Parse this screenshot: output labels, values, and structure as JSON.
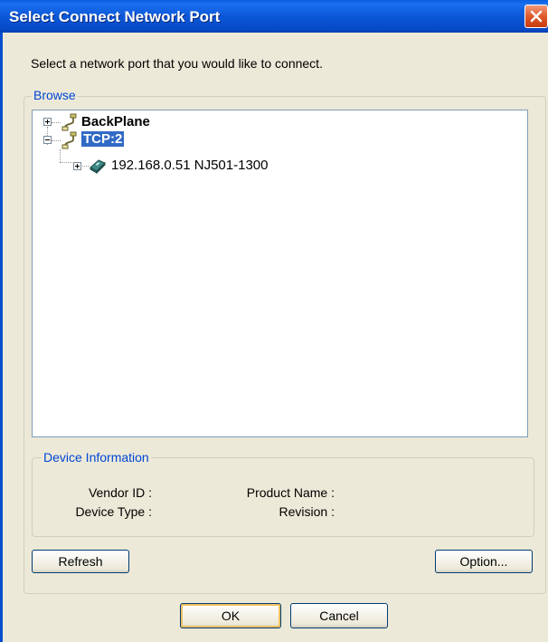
{
  "window": {
    "title": "Select Connect Network Port"
  },
  "prompt": "Select a network port that you would like to connect.",
  "browse": {
    "label": "Browse",
    "tree": [
      {
        "label": "BackPlane",
        "icon": "port-plug-icon",
        "expanded": false,
        "bold": true
      },
      {
        "label": "TCP:2",
        "icon": "port-plug-icon",
        "expanded": true,
        "bold": true,
        "selected": true
      },
      {
        "label": "192.168.0.51 NJ501-1300",
        "icon": "controller-device-icon",
        "expanded": false,
        "bold": false
      }
    ]
  },
  "device_info": {
    "label": "Device Information",
    "vendor_id_label": "Vendor ID :",
    "device_type_label": "Device Type :",
    "product_name_label": "Product Name :",
    "revision_label": "Revision :"
  },
  "buttons": {
    "refresh": "Refresh",
    "option": "Option...",
    "ok": "OK",
    "cancel": "Cancel"
  },
  "colors": {
    "titlebar": "#0a5fe0",
    "selection": "#316ac5",
    "groupbox_label": "#0046d5"
  }
}
